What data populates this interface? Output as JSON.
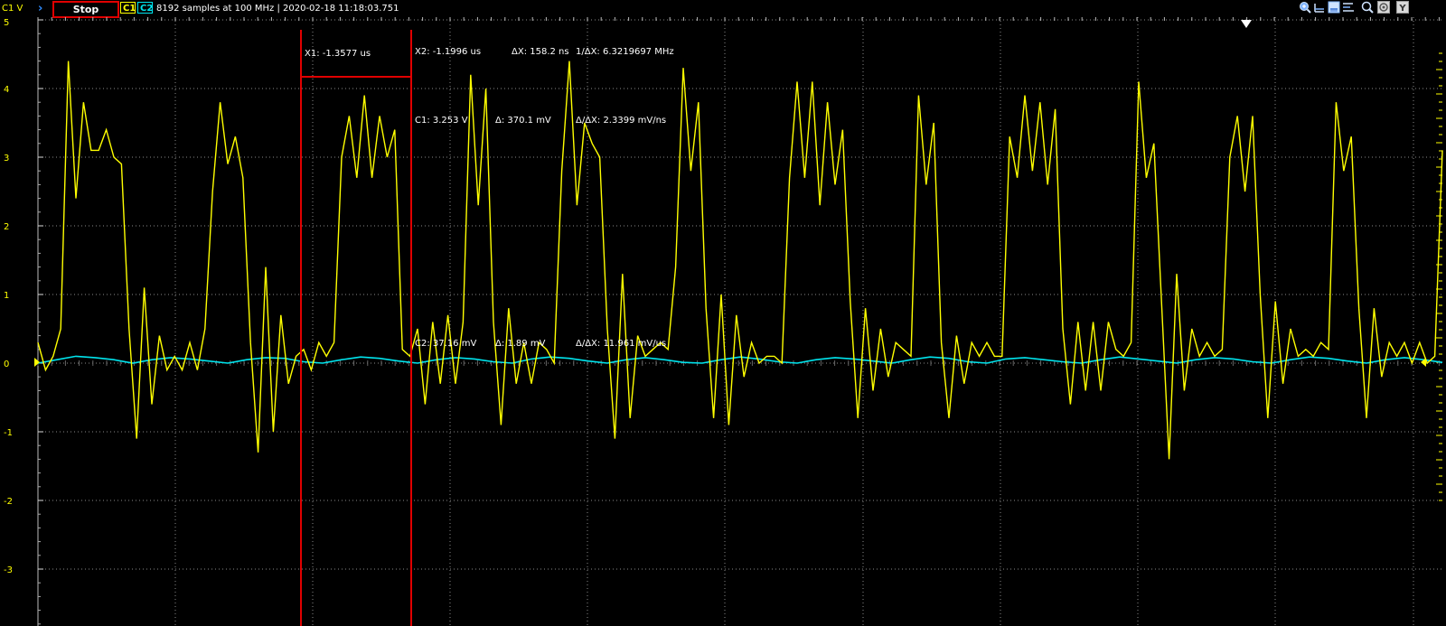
{
  "toolbar": {
    "unit_label": "C1 V",
    "run_indicator": "›",
    "stop_label": "Stop",
    "c1_label": "C1",
    "c2_label": "C2",
    "acquisition_info": "8192 samples at 100 MHz | 2020-02-18 11:18:03.751",
    "tools": [
      "zoom-in-icon",
      "cursor-horizontal-icon",
      "cursor-box-icon",
      "cursor-bars-icon",
      "zoom-search-icon",
      "settings-icon",
      "y-axis-icon"
    ],
    "y_button_label": "Y"
  },
  "y_axis": {
    "ticks": [
      "5",
      "4",
      "3",
      "2",
      "1",
      "0",
      "-1",
      "-2",
      "-3"
    ]
  },
  "cursors": {
    "x1": "X1: -1.3577 us",
    "x2": "X2: -1.1996 us",
    "delta_x": "ΔX: 158.2 ns",
    "inv_delta_x": "1/ΔX: 6.3219697 MHz",
    "c1_value": "C1: 3.253 V",
    "c1_delta": "Δ: 370.1 mV",
    "c1_slope": "Δ/ΔX: 2.3399 mV/ns",
    "c2_value": "C2: 37.16 mV",
    "c2_delta": "Δ: 1.89 mV",
    "c2_slope": "Δ/ΔX: 11.961 mV/us"
  },
  "colors": {
    "c1": "#ffff00",
    "c2": "#00e5ee",
    "cursor": "#e00000",
    "grid": "#8a8a8a",
    "background": "#000000"
  },
  "chart_data": {
    "type": "line",
    "title": "",
    "ylim": [
      -3.5,
      5
    ],
    "y_ticks": [
      -3,
      -2,
      -1,
      0,
      1,
      2,
      3,
      4,
      5
    ],
    "series": [
      {
        "name": "C1",
        "values": [
          0.3,
          -0.1,
          0.1,
          0.5,
          4.4,
          2.4,
          3.8,
          3.1,
          3.1,
          3.4,
          3.0,
          2.9,
          0.5,
          -1.1,
          1.1,
          -0.6,
          0.4,
          -0.1,
          0.1,
          -0.1,
          0.3,
          -0.1,
          0.5,
          2.5,
          3.8,
          2.9,
          3.3,
          2.7,
          0.3,
          -1.3,
          1.4,
          -1.0,
          0.7,
          -0.3,
          0.1,
          0.2,
          -0.1,
          0.3,
          0.1,
          0.3,
          3.0,
          3.6,
          2.7,
          3.9,
          2.7,
          3.6,
          3.0,
          3.4,
          0.2,
          0.1,
          0.5,
          -0.6,
          0.6,
          -0.3,
          0.7,
          -0.3,
          0.6,
          4.2,
          2.3,
          4.0,
          0.6,
          -0.9,
          0.8,
          -0.3,
          0.3,
          -0.3,
          0.3,
          0.2,
          0.0,
          2.8,
          4.4,
          2.3,
          3.5,
          3.2,
          3.0,
          0.5,
          -1.1,
          1.3,
          -0.8,
          0.4,
          0.1,
          0.2,
          0.3,
          0.2,
          1.4,
          4.3,
          2.8,
          3.8,
          0.8,
          -0.8,
          1.0,
          -0.9,
          0.7,
          -0.2,
          0.3,
          0.0,
          0.1,
          0.1,
          0.0,
          2.7,
          4.1,
          2.7,
          4.1,
          2.3,
          3.8,
          2.6,
          3.4,
          0.9,
          -0.8,
          0.8,
          -0.4,
          0.5,
          -0.2,
          0.3,
          0.2,
          0.1,
          3.9,
          2.6,
          3.5,
          0.3,
          -0.8,
          0.4,
          -0.3,
          0.3,
          0.1,
          0.3,
          0.1,
          0.1,
          3.3,
          2.7,
          3.9,
          2.8,
          3.8,
          2.6,
          3.7,
          0.5,
          -0.6,
          0.6,
          -0.4,
          0.6,
          -0.4,
          0.6,
          0.2,
          0.1,
          0.3,
          4.1,
          2.7,
          3.2,
          0.9,
          -1.4,
          1.3,
          -0.4,
          0.5,
          0.1,
          0.3,
          0.1,
          0.2,
          3.0,
          3.6,
          2.5,
          3.6,
          1.0,
          -0.8,
          0.9,
          -0.3,
          0.5,
          0.1,
          0.2,
          0.1,
          0.3,
          0.2,
          3.8,
          2.8,
          3.3,
          0.8,
          -0.8,
          0.8,
          -0.2,
          0.3,
          0.1,
          0.3,
          0.0,
          0.3,
          0.0,
          0.1,
          3.1
        ]
      },
      {
        "name": "C2",
        "values": [
          0.0,
          0.05,
          0.1,
          0.08,
          0.05,
          0.0,
          0.05,
          0.08,
          0.06,
          0.03,
          0.0,
          0.05,
          0.08,
          0.07,
          0.02,
          0.0,
          0.05,
          0.09,
          0.07,
          0.03,
          0.0,
          0.05,
          0.08,
          0.06,
          0.02,
          0.0,
          0.06,
          0.09,
          0.07,
          0.03,
          0.0,
          0.05,
          0.08,
          0.05,
          0.01,
          0.0,
          0.05,
          0.09,
          0.06,
          0.02,
          0.0,
          0.05,
          0.08,
          0.06,
          0.03,
          0.0,
          0.05,
          0.09,
          0.07,
          0.02,
          0.0,
          0.06,
          0.08,
          0.05,
          0.02,
          0.0,
          0.05,
          0.09,
          0.06,
          0.03,
          0.0,
          0.05,
          0.08,
          0.06,
          0.02,
          0.0,
          0.05,
          0.09,
          0.07,
          0.03,
          0.0,
          0.05,
          0.08,
          0.05,
          0.01
        ]
      }
    ]
  }
}
